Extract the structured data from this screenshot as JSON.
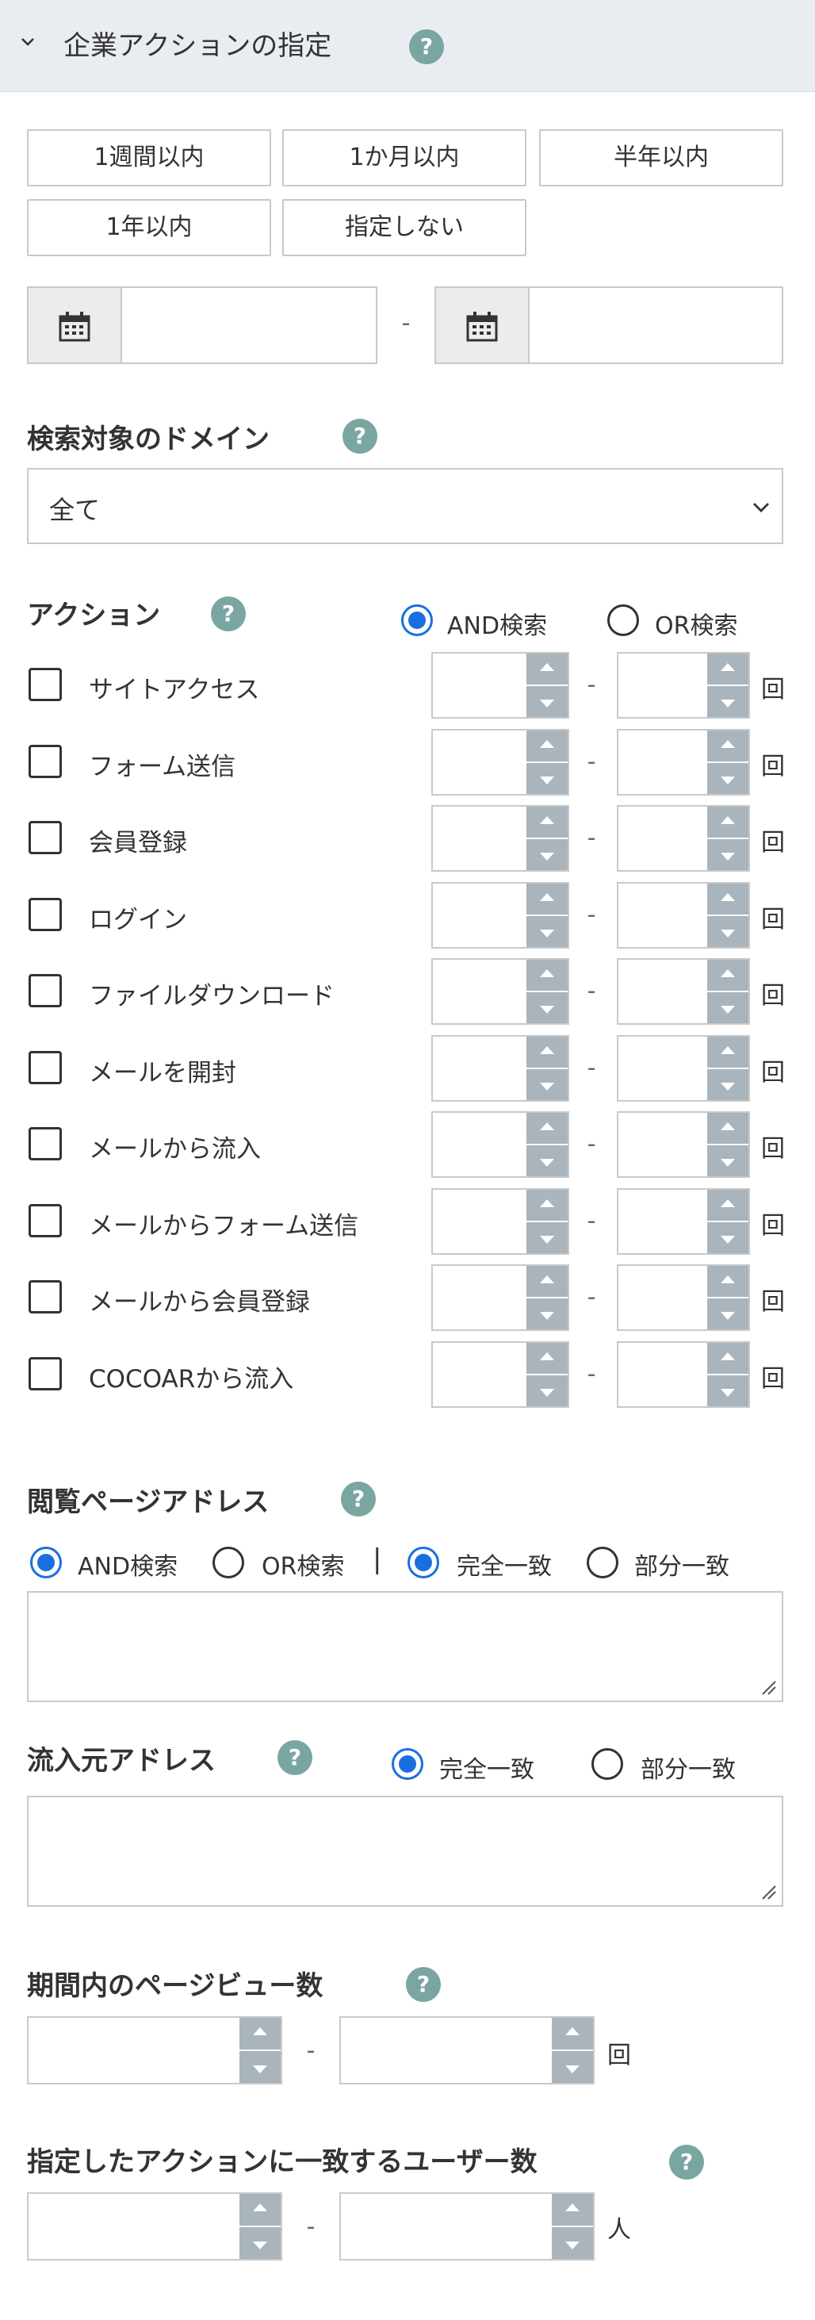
{
  "header": {
    "title": "企業アクションの指定",
    "help": "?"
  },
  "period_buttons": [
    "1週間以内",
    "1か月以内",
    "半年以内",
    "1年以内",
    "指定しない"
  ],
  "date_range": {
    "separator": "-"
  },
  "domain": {
    "label": "検索対象のドメイン",
    "help": "?",
    "selected": "全て"
  },
  "actions": {
    "label": "アクション",
    "help": "?",
    "and_label": "AND検索",
    "or_label": "OR検索",
    "selected_mode": "AND",
    "separator": "-",
    "unit": "回",
    "items": [
      "サイトアクセス",
      "フォーム送信",
      "会員登録",
      "ログイン",
      "ファイルダウンロード",
      "メールを開封",
      "メールから流入",
      "メールからフォーム送信",
      "メールから会員登録",
      "COCOARから流入"
    ]
  },
  "page_address": {
    "label": "閲覧ページアドレス",
    "help": "?",
    "and_label": "AND検索",
    "or_label": "OR検索",
    "divider": "|",
    "exact_label": "完全一致",
    "partial_label": "部分一致",
    "selected_mode": "AND",
    "selected_match": "exact"
  },
  "referrer": {
    "label": "流入元アドレス",
    "help": "?",
    "exact_label": "完全一致",
    "partial_label": "部分一致",
    "selected_match": "exact"
  },
  "pageviews": {
    "label": "期間内のページビュー数",
    "help": "?",
    "separator": "-",
    "unit": "回"
  },
  "users": {
    "label": "指定したアクションに一致するユーザー数",
    "help": "?",
    "separator": "-",
    "unit": "人"
  },
  "colors": {
    "accent": "#1a6fe0",
    "help_bg": "#7aa6a1",
    "header_bg": "#e9edf2",
    "spinner": "#a9b4bc"
  }
}
